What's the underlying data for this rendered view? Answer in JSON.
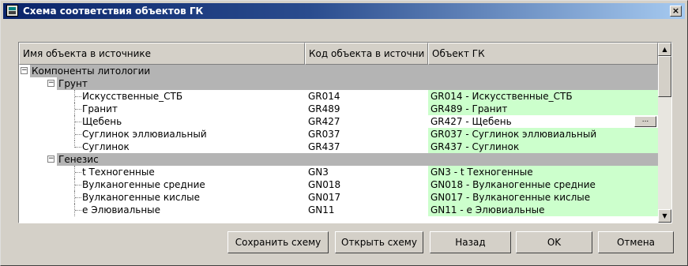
{
  "window": {
    "title": "Схема соответствия объектов ГК",
    "close_label": "×"
  },
  "table": {
    "headers": [
      "Имя объекта в источнике",
      "Код объекта в источни",
      "Объект ГК"
    ],
    "groups": [
      {
        "label": "Компоненты литологии",
        "level": 0,
        "expanded": true
      },
      {
        "label": "Грунт",
        "level": 1,
        "expanded": true
      },
      {
        "label": "Генезис",
        "level": 1,
        "expanded": true
      }
    ],
    "rows": [
      {
        "name": "Искусственные_СТБ",
        "code": "GR014",
        "object": "GR014 - Искусственные_СТБ"
      },
      {
        "name": "Гранит",
        "code": "GR489",
        "object": "GR489 - Гранит"
      },
      {
        "name": "Щебень",
        "code": "GR427",
        "object": "GR427 - Щебень",
        "selected": true
      },
      {
        "name": "Суглинок эллювиальный",
        "code": "GR037",
        "object": "GR037 - Суглинок эллювиальный"
      },
      {
        "name": "Суглинок",
        "code": "GR437",
        "object": "GR437 - Суглинок"
      },
      {
        "name": "t Техногенные",
        "code": "GN3",
        "object": "GN3 - t Техногенные"
      },
      {
        "name": "Вулканогенные средние",
        "code": "GN018",
        "object": "GN018 - Вулканогенные средние"
      },
      {
        "name": "Вулканогенные кислые",
        "code": "GN017",
        "object": "GN017 - Вулканогенные кислые"
      },
      {
        "name": "e Элювиальные",
        "code": "GN11",
        "object": "GN11 - e Элювиальные"
      }
    ],
    "ellipsis_label": "...",
    "expand_symbol": "−"
  },
  "buttons": {
    "save_scheme": "Сохранить схему",
    "open_scheme": "Открыть схему",
    "back": "Назад",
    "ok": "OK",
    "cancel": "Отмена"
  },
  "colors": {
    "title_start": "#0a246a",
    "title_end": "#a6caf0",
    "mapped_bg": "#ccffcc",
    "group_bg": "#b4b4b4",
    "dialog_bg": "#d4d0c8"
  }
}
